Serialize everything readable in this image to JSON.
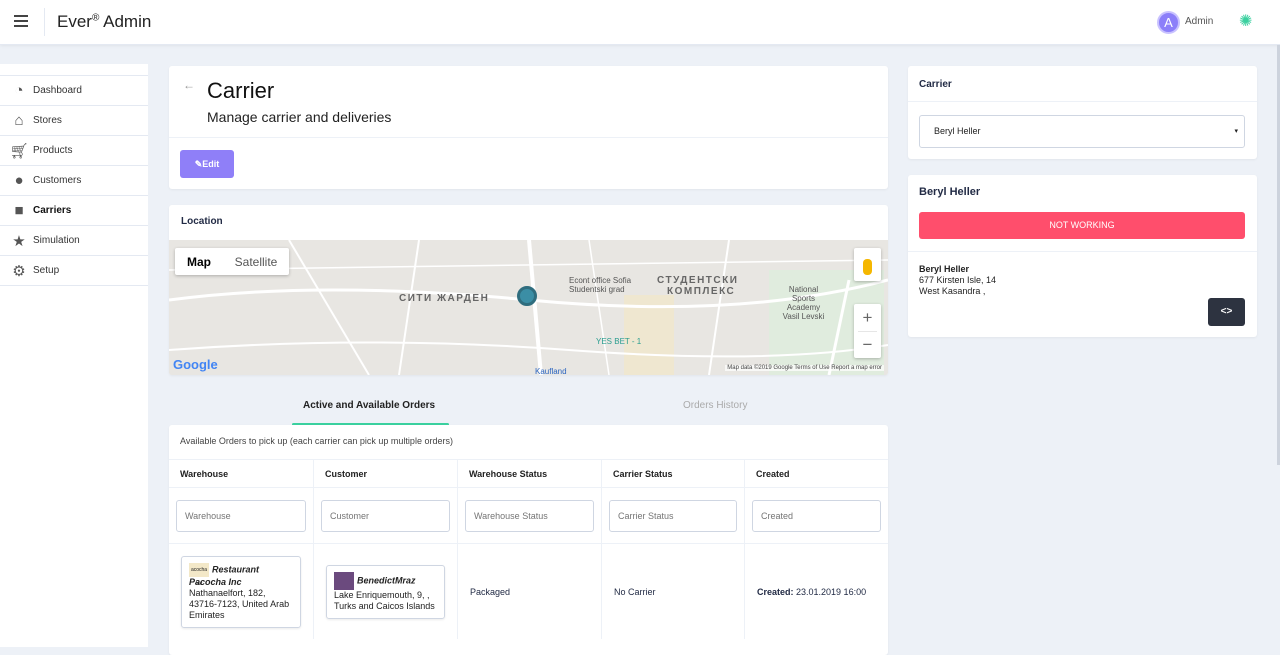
{
  "header": {
    "brand": "Ever",
    "brand_sup": "®",
    "brand_suffix": " Admin",
    "avatar_letter": "A",
    "user_name": "Admin"
  },
  "sidebar": {
    "items": [
      {
        "label": "Dashboard",
        "icon": "dashboard-icon"
      },
      {
        "label": "Stores",
        "icon": "home-icon"
      },
      {
        "label": "Products",
        "icon": "cart-icon"
      },
      {
        "label": "Customers",
        "icon": "person-icon"
      },
      {
        "label": "Carriers",
        "icon": "truck-icon"
      },
      {
        "label": "Simulation",
        "icon": "star-icon"
      },
      {
        "label": "Setup",
        "icon": "gear-icon"
      }
    ]
  },
  "page": {
    "title": "Carrier",
    "subtitle": "Manage carrier and deliveries",
    "edit_label": "Edit"
  },
  "location": {
    "title": "Location",
    "map_label": "Map",
    "satellite_label": "Satellite",
    "google": "Google",
    "attribution": "Map data ©2019 Google   Terms of Use   Report a map error",
    "labels": {
      "a": "СИТИ ЖАРДЕН",
      "b": "СТУДЕНТСКИ",
      "c": "КОМПЛЕКС",
      "d": "Econt office Sofia Studentski grad",
      "e": "YES BET - 1",
      "f": "National Sports Academy Vasil Levski",
      "g": "Kaufland"
    }
  },
  "tabs": {
    "active": "Active and Available Orders",
    "history": "Orders History"
  },
  "orders": {
    "caption": "Available Orders to pick up (each carrier can pick up multiple orders)",
    "columns": [
      "Warehouse",
      "Customer",
      "Warehouse Status",
      "Carrier Status",
      "Created"
    ],
    "filters": [
      "Warehouse",
      "Customer",
      "Warehouse Status",
      "Carrier Status",
      "Created"
    ],
    "rows": [
      {
        "warehouse_name": "Restaurant Pacocha Inc",
        "warehouse_logo": "acocha Inc",
        "warehouse_address": "Nathanaelfort, 182, 43716-7123, United Arab Emirates",
        "customer_name": "BenedictMraz",
        "customer_address": "Lake Enriquemouth, 9, , Turks and Caicos Islands",
        "warehouse_status": "Packaged",
        "carrier_status": "No Carrier",
        "created_label": "Created:",
        "created_value": " 23.01.2019 16:00"
      }
    ]
  },
  "carrier_select": {
    "title": "Carrier",
    "value": "Beryl Heller",
    "arrow": "▾"
  },
  "carrier_info": {
    "name": "Beryl Heller",
    "status": "NOT WORKING",
    "addr_name": "Beryl Heller",
    "addr_line1": "677 Kirsten Isle, 14",
    "addr_line2": "West Kasandra ,",
    "code_label": "<>"
  },
  "colors": {
    "accent": "#8f7ff8",
    "danger": "#ff4e6c",
    "success": "#3ad09f"
  }
}
